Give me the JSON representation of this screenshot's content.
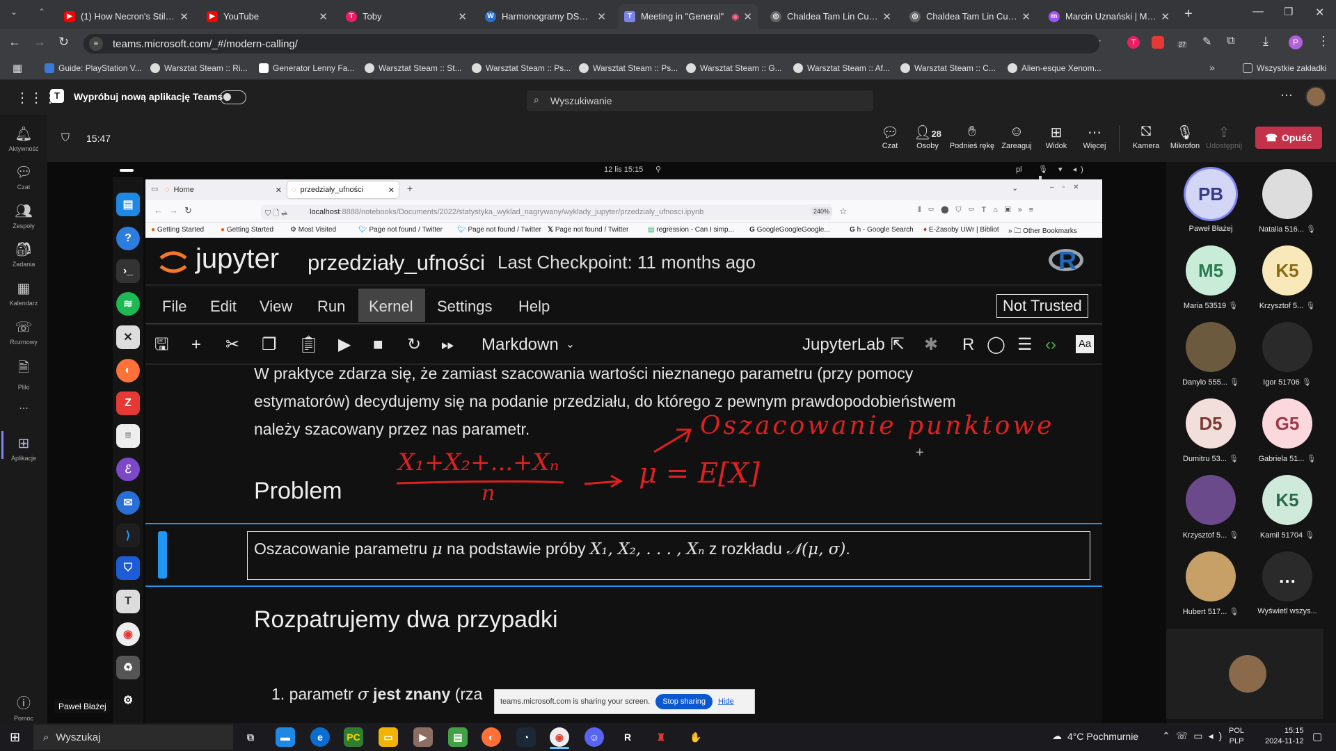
{
  "browser": {
    "tabs": [
      {
        "title": "(1) How Necron's Stilling",
        "icon_color": "#ff0000",
        "icon": "youtube-icon"
      },
      {
        "title": "YouTube",
        "icon_color": "#ff0000",
        "icon": "youtube-icon"
      },
      {
        "title": "Toby",
        "icon_color": "#e91e63",
        "icon": "toby-icon"
      },
      {
        "title": "Harmonogramy DSW - P",
        "icon_color": "#2c6ecb",
        "icon": "wordpress-icon"
      },
      {
        "title": "Meeting in \"General\"",
        "icon_color": "#7b83eb",
        "icon": "teams-icon"
      },
      {
        "title": "Chaldea Tam Lin Cup - W",
        "icon_color": "#888888",
        "icon": "globe-icon"
      },
      {
        "title": "Chaldea Tam Lin Cup - E",
        "icon_color": "#888888",
        "icon": "globe-icon"
      },
      {
        "title": "Marcin Uznański | Messe",
        "icon_color": "#a050ff",
        "icon": "messenger-icon"
      }
    ],
    "url": "teams.microsoft.com/_#/modern-calling/",
    "extension_badge": "27",
    "profile_initial": "P",
    "bookmarks": [
      "Guide: PlayStation V...",
      "Warsztat Steam :: Ri...",
      "Generator Lenny Fa...",
      "Warsztat Steam :: St...",
      "Warsztat Steam :: Ps...",
      "Warsztat Steam :: Ps...",
      "Warsztat Steam :: G...",
      "Warsztat Steam :: Af...",
      "Warsztat Steam :: C...",
      "Alien-esque Xenom..."
    ],
    "all_bookmarks": "Wszystkie zakładki"
  },
  "teams": {
    "try_new": "Wypróbuj nową aplikację Teams",
    "search_placeholder": "Wyszukiwanie",
    "rail": [
      "Aktywność",
      "Czat",
      "Zespoły",
      "Zadania",
      "Kalendarz",
      "Rozmowy",
      "Pliki",
      "...",
      "Aplikacje",
      "Pomoc"
    ],
    "meeting_time": "15:47",
    "people_count": "28",
    "controls": [
      "Czat",
      "Osoby",
      "Podnieś rękę",
      "Zareaguj",
      "Widok",
      "Więcej",
      "Kamera",
      "Mikrofon",
      "Udostępnij"
    ],
    "leave": "Opuść",
    "presenter_label": "Paweł Błażej"
  },
  "participants": [
    {
      "initials": "PB",
      "name": "Paweł Błażej",
      "bg": "#d4d6f5",
      "fg": "#383a8a"
    },
    {
      "initials": "",
      "name": "Natalia 516...",
      "bg": "#dddddd",
      "fg": "#000"
    },
    {
      "initials": "M5",
      "name": "Maria 53519",
      "bg": "#c9ecd9",
      "fg": "#2a7a4e"
    },
    {
      "initials": "K5",
      "name": "Krzysztof 5...",
      "bg": "#f9e8b9",
      "fg": "#8a6a10"
    },
    {
      "initials": "",
      "name": "Danylo 555...",
      "bg": "#6b5a3e",
      "fg": "#fff"
    },
    {
      "initials": "",
      "name": "Igor 51706",
      "bg": "#2a2a2a",
      "fg": "#d02020"
    },
    {
      "initials": "D5",
      "name": "Dumitru 53...",
      "bg": "#f2dedb",
      "fg": "#7a3b33"
    },
    {
      "initials": "G5",
      "name": "Gabriela 51...",
      "bg": "#fbd8de",
      "fg": "#9a3a4c"
    },
    {
      "initials": "",
      "name": "Krzysztof 5...",
      "bg": "#6a4a8a",
      "fg": "#fff"
    },
    {
      "initials": "K5",
      "name": "Kamil 51704",
      "bg": "#cfeadb",
      "fg": "#2a6a4a"
    },
    {
      "initials": "",
      "name": "Hubert 517...",
      "bg": "#c6a066",
      "fg": "#fff"
    },
    {
      "initials": "…",
      "name": "Wyświetl wszys...",
      "bg": "#2a2a2a",
      "fg": "#fff"
    }
  ],
  "shared": {
    "linux_time": "12 lis  15:15",
    "lang": "pl",
    "ff_tabs": [
      "Home",
      "przedziały_ufności"
    ],
    "ff_url_host": "localhost",
    "ff_url_path": ":8888/notebooks/Documents/2022/statystyka_wyklad_nagrywany/wyklady_jupyter/przedzialy_ufnosci.ipynb",
    "ff_zoom": "240%",
    "ff_bookmarks": [
      "Getting Started",
      "Getting Started",
      "Most Visited",
      "Page not found / Twitter",
      "Page not found / Twitter",
      "Page not found / Twitter",
      "regression - Can I simp...",
      "GoogleGoogleGoogle...",
      "h - Google Search",
      "E-Zasoby UWr | Bibliot",
      "Other Bookmarks"
    ],
    "jupyter_logo": "jupyter",
    "notebook_name": "przedziały_ufności",
    "checkpoint": "Last Checkpoint: 11 months ago",
    "menu": [
      "File",
      "Edit",
      "View",
      "Run",
      "Kernel",
      "Settings",
      "Help"
    ],
    "trust": "Not Trusted",
    "cell_type": "Markdown",
    "jupyterlab": "JupyterLab",
    "kernel": "R",
    "para1": "W praktyce zdarza się, że zamiast szacowania wartości nieznanego parametru (przy pomocy",
    "para2": "estymatorów) decydujemy się na podanie przedziału, do którego z pewnym prawdopodobieństwem",
    "para3": "należy szacowany przez nas parametr.",
    "heading1": "Problem",
    "cell_text_a": "Oszacowanie parametru ",
    "cell_text_b": " na podstawie próby ",
    "cell_text_c": " z rozkładu ",
    "math_mu": "μ",
    "math_sample": "X₁, X₂, . . . , Xₙ",
    "math_dist": "𝒩(μ, σ)",
    "heading2": "Rozpatrujemy dwa przypadki",
    "list_item_num": "1. parametr ",
    "list_sigma": "σ",
    "list_bold": "jest znany",
    "list_rest": " (rza",
    "ink_top": "Oszacowanie punktowe",
    "ink_formula_left": "X₁+X₂+...+Xₙ",
    "ink_den": "n",
    "ink_formula_right": "μ = E[X]",
    "share_msg": "teams.microsoft.com is sharing your screen.",
    "stop_sharing": "Stop sharing",
    "hide": "Hide"
  },
  "taskbar": {
    "search": "Wyszukaj",
    "weather": "4°C  Pochmurnie",
    "lang1": "POL",
    "lang2": "PLP",
    "time": "15:15",
    "date": "2024-11-12"
  },
  "colors": {
    "leave": "#c4314b",
    "teams_accent": "#5b5fc7",
    "ink": "#e02020",
    "jupyter_orange": "#f37726"
  }
}
